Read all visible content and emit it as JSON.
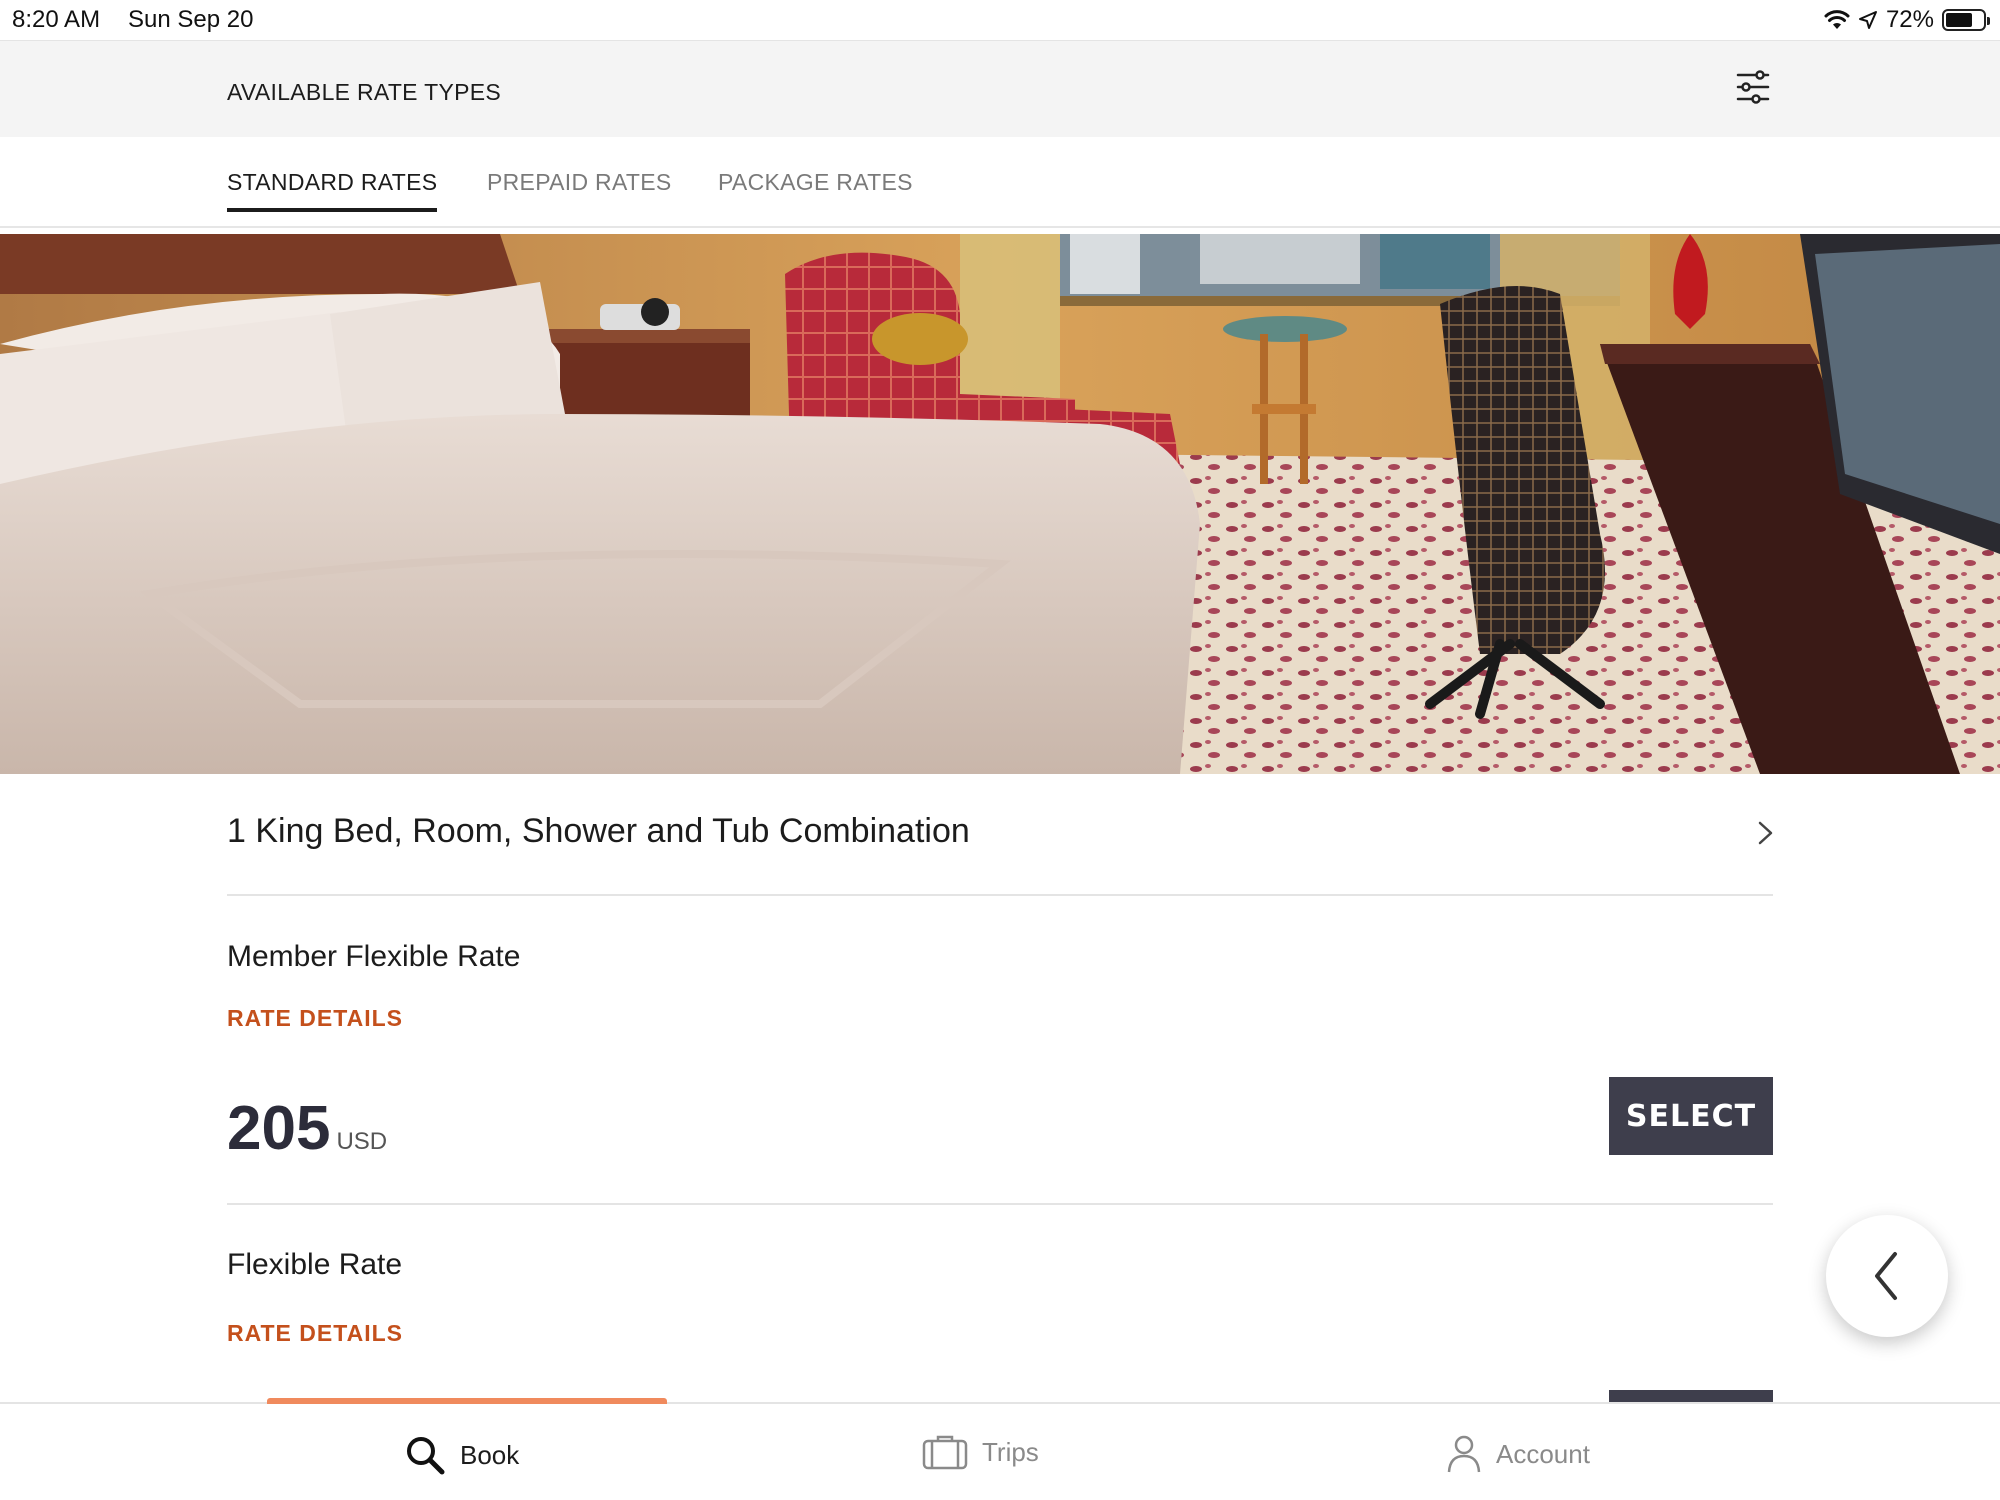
{
  "status_bar": {
    "time": "8:20 AM",
    "date": "Sun Sep 20",
    "battery": "72%",
    "battery_level": 0.72
  },
  "header": {
    "title": "AVAILABLE RATE TYPES",
    "filter_icon": "sliders-icon"
  },
  "tabs": [
    {
      "label": "STANDARD RATES",
      "active": true
    },
    {
      "label": "PREPAID RATES",
      "active": false
    },
    {
      "label": "PACKAGE RATES",
      "active": false
    }
  ],
  "room": {
    "title": "1 King Bed, Room, Shower and Tub Combination"
  },
  "rates": [
    {
      "name": "Member Flexible Rate",
      "details_label": "RATE DETAILS",
      "price": "205",
      "currency": "USD",
      "select_label": "SELECT"
    },
    {
      "name": "Flexible Rate",
      "details_label": "RATE DETAILS"
    }
  ],
  "bottom_nav": [
    {
      "label": "Book",
      "icon": "search-icon",
      "active": true
    },
    {
      "label": "Trips",
      "icon": "suitcase-icon",
      "active": false
    },
    {
      "label": "Account",
      "icon": "person-icon",
      "active": false
    }
  ],
  "colors": {
    "accent": "#c4501c",
    "button": "#3e3e4c",
    "nav_indicator": "#f08a5d",
    "header_bg": "#f4f4f4"
  }
}
